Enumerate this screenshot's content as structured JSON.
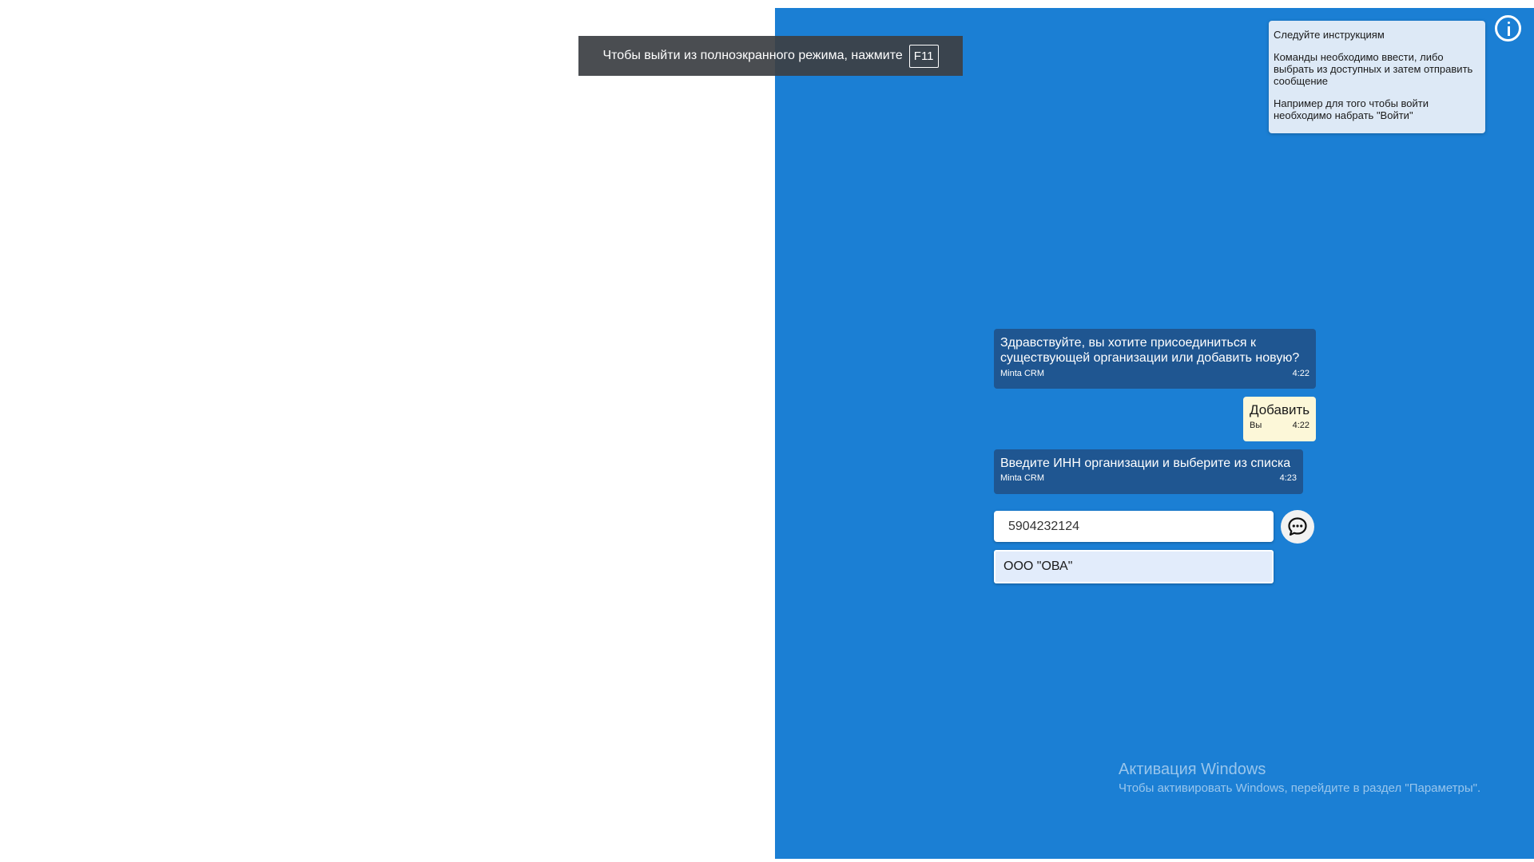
{
  "fullscreen_toast": {
    "text": "Чтобы выйти из полноэкранного режима, нажмите",
    "key": "F11"
  },
  "instructions": {
    "title": "Следуйте инструкциям",
    "line1": "Команды необходимо ввести, либо выбрать из доступных и затем отправить сообщение",
    "line2": "Например для того чтобы войти необходимо набрать \"Войти\""
  },
  "chat": {
    "messages": [
      {
        "text": "Здравствуйте, вы хотите присоединиться к существующей организации или добавить новую?",
        "sender": "Minta CRM",
        "time": "4:22"
      },
      {
        "text": "Добавить",
        "sender": "Вы",
        "time": "4:22"
      },
      {
        "text": "Введите ИНН организации и выберите из списка",
        "sender": "Minta CRM",
        "time": "4:23"
      }
    ],
    "input_value": "5904232124",
    "suggestions": [
      "ООО \"ОВА\""
    ]
  },
  "activation": {
    "title": "Активация Windows",
    "subtitle": "Чтобы активировать Windows, перейдите в раздел \"Параметры\"."
  },
  "icons": {
    "info": "info-circle-icon",
    "send": "chat-bubble-icon"
  },
  "colors": {
    "panel": "#1b7fd4",
    "bot_bubble": "#1f5691",
    "user_bubble": "#fcf7d8",
    "instructions_bg": "#dde9f6"
  }
}
